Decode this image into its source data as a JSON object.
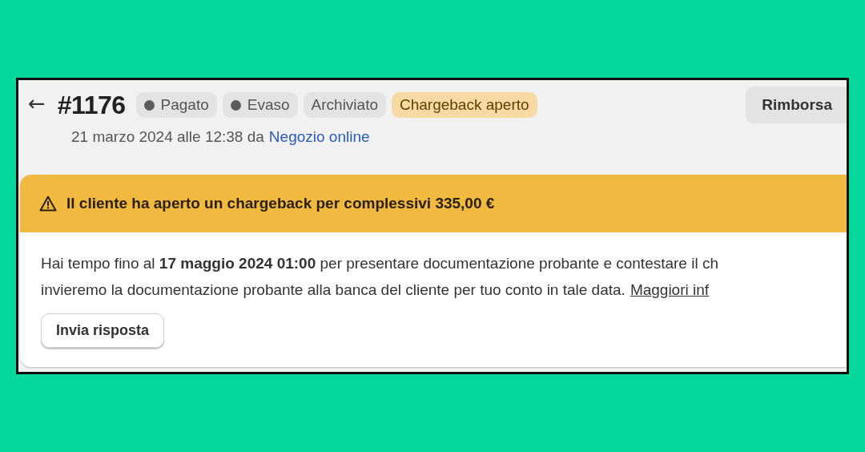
{
  "header": {
    "back": "←",
    "order_number": "#1176",
    "badges": [
      {
        "label": "Pagato",
        "kind": "dot"
      },
      {
        "label": "Evaso",
        "kind": "dot"
      },
      {
        "label": "Archiviato",
        "kind": "plain"
      },
      {
        "label": "Chargeback aperto",
        "kind": "warning"
      }
    ],
    "action_button": "Rimborsa",
    "meta": "21 marzo 2024 alle 12:38 da",
    "meta_link": "Negozio online"
  },
  "alert": {
    "title": "Il cliente ha aperto un chargeback per complessivi 335,00 €",
    "lines": [
      "Hai tempo fino al **17 maggio 2024 01:00** per presentare documentazione probante e contestare il ch",
      "invieremo la documentazione probante alla banca del cliente per tuo conto in tale data."
    ],
    "link": "Maggiori inf",
    "button": "Invia risposta"
  }
}
